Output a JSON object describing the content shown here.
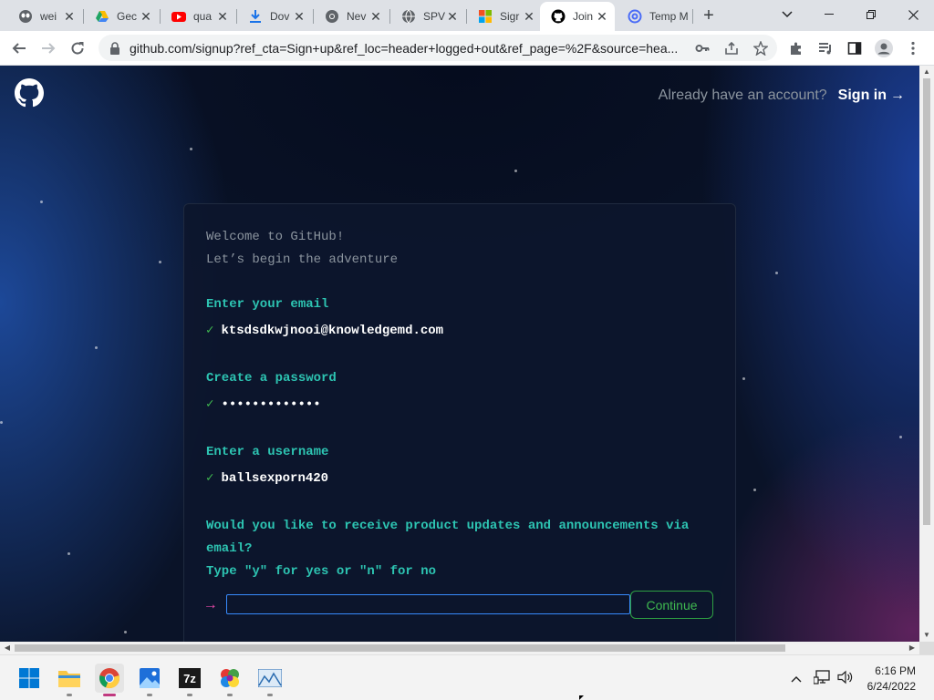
{
  "browser": {
    "tabs": [
      {
        "title": "wei",
        "icon": "alien-face-icon",
        "color": "#5f6368"
      },
      {
        "title": "Gec",
        "icon": "google-drive-icon",
        "color": "#1fa463"
      },
      {
        "title": "qua",
        "icon": "youtube-icon",
        "color": "#ff0000"
      },
      {
        "title": "Dov",
        "icon": "download-icon",
        "color": "#1a73e8"
      },
      {
        "title": "Nev",
        "icon": "chrome-icon",
        "color": "#5f6368"
      },
      {
        "title": "SPV",
        "icon": "globe-icon",
        "color": "#5f6368"
      },
      {
        "title": "Sigr",
        "icon": "microsoft-icon",
        "color": "#f25022"
      },
      {
        "title": "Join",
        "icon": "github-icon",
        "color": "#000000"
      },
      {
        "title": "Temp M",
        "icon": "at-sign-icon",
        "color": "#4a6cf7"
      }
    ],
    "close_glyph": "✕",
    "new_tab_glyph": "+",
    "url": "github.com/signup?ref_cta=Sign+up&ref_loc=header+logged+out&ref_page=%2F&source=hea..."
  },
  "page": {
    "header": {
      "question": "Already have an account?",
      "signin_label": "Sign in",
      "signin_arrow": "→"
    },
    "greeting_line1": "Welcome to GitHub!",
    "greeting_line2": "Let’s begin the adventure",
    "steps": [
      {
        "prompt": "Enter your email",
        "answer": "ktsdsdkwjnooi@knowledgemd.com"
      },
      {
        "prompt": "Create a password",
        "answer": "•••••••••••••"
      },
      {
        "prompt": "Enter a username",
        "answer": "ballsexporn420"
      }
    ],
    "check_glyph": "✓",
    "marketing_question_line1": "Would you like to receive product updates and announcements via",
    "marketing_question_line2": "email?",
    "marketing_hint": "Type \"y\" for yes or \"n\" for no",
    "input_arrow": "→",
    "input_value": "",
    "continue_label": "Continue"
  },
  "taskbar": {
    "time": "6:16 PM",
    "date": "6/24/2022",
    "apps": [
      {
        "name": "start-button",
        "icon": "windows-logo-icon"
      },
      {
        "name": "file-explorer",
        "icon": "folder-icon"
      },
      {
        "name": "chrome",
        "icon": "chrome-icon",
        "active": true
      },
      {
        "name": "photos",
        "icon": "photos-icon"
      },
      {
        "name": "7zip",
        "icon": "7zip-icon",
        "label": "7z"
      },
      {
        "name": "paint-app",
        "icon": "colorful-app-icon"
      },
      {
        "name": "image-viewer",
        "icon": "landscape-icon"
      }
    ]
  },
  "colors": {
    "accent_teal": "#2dc4b2",
    "check_green": "#3fb950",
    "arrow_pink": "#ea4aaa",
    "input_border": "#388bfd"
  }
}
